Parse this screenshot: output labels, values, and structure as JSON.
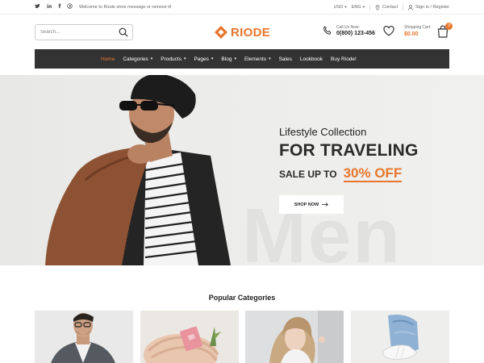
{
  "topbar": {
    "social": [
      {
        "icon": "twitter-icon",
        "glyph": "𝕥"
      },
      {
        "icon": "linkedin-icon",
        "glyph": "in"
      },
      {
        "icon": "facebook-icon",
        "glyph": "f"
      },
      {
        "icon": "pinterest-icon",
        "glyph": "℗"
      }
    ],
    "welcome": "Welcome to Riode store message or remove it!",
    "currency": "USD",
    "language": "ENG",
    "contact": "Contact",
    "signin": "Sign in / Register"
  },
  "header": {
    "search_placeholder": "Search...",
    "logo_text": "RIODE",
    "call_label": "Call Us Now:",
    "call_number": "0(800) 123-456",
    "cart_label": "Shopping Cart:",
    "cart_total": "$0.00",
    "cart_count": "0",
    "brand_color": "#e8762c"
  },
  "nav": {
    "items": [
      {
        "label": "Home",
        "active": true,
        "caret": false
      },
      {
        "label": "Categories",
        "active": false,
        "caret": true
      },
      {
        "label": "Products",
        "active": false,
        "caret": true
      },
      {
        "label": "Pages",
        "active": false,
        "caret": true
      },
      {
        "label": "Blog",
        "active": false,
        "caret": true
      },
      {
        "label": "Elements",
        "active": false,
        "caret": true
      },
      {
        "label": "Sales",
        "active": false,
        "caret": false
      },
      {
        "label": "Lookbook",
        "active": false,
        "caret": false
      },
      {
        "label": "Buy Riode!",
        "active": false,
        "caret": false
      }
    ]
  },
  "hero": {
    "subtitle": "Lifestyle Collection",
    "title": "FOR TRAVELING",
    "sale_prefix": "SALE UP TO",
    "sale_value": "30% OFF",
    "button": "SHOP NOW",
    "watermark": "Men"
  },
  "categories": {
    "title": "Popular Categories",
    "cards": [
      {
        "name": "men-category-image"
      },
      {
        "name": "accessories-category-image"
      },
      {
        "name": "women-category-image"
      },
      {
        "name": "shoes-category-image"
      }
    ]
  }
}
